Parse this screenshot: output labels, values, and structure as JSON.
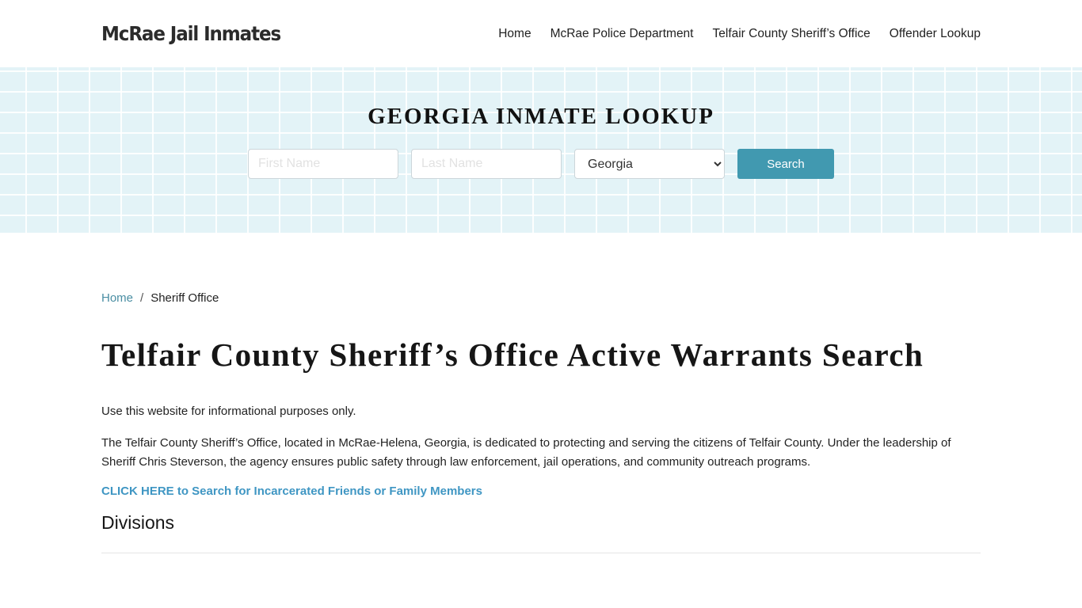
{
  "header": {
    "logo": "McRae Jail Inmates",
    "nav": [
      {
        "label": "Home"
      },
      {
        "label": "McRae Police Department"
      },
      {
        "label": "Telfair County Sheriff’s Office"
      },
      {
        "label": "Offender Lookup"
      }
    ]
  },
  "banner": {
    "title": "GEORGIA INMATE LOOKUP",
    "first_name_placeholder": "First Name",
    "last_name_placeholder": "Last Name",
    "state_selected": "Georgia",
    "search_label": "Search",
    "colors": {
      "background": "#e3f3f7",
      "button": "#4199b0"
    }
  },
  "breadcrumb": {
    "home": "Home",
    "separator": "/",
    "current": "Sheriff Office"
  },
  "main": {
    "title": "Telfair County Sheriff’s Office Active Warrants Search",
    "disclaimer": "Use this website for informational purposes only.",
    "intro": "The Telfair County Sheriff’s Office, located in McRae-Helena, Georgia, is dedicated to protecting and serving the citizens of Telfair County. Under the leadership of Sheriff Chris Steverson, the agency ensures public safety through law enforcement, jail operations, and community outreach programs.",
    "cta_link": "CLICK HERE to Search for Incarcerated Friends or Family Members",
    "section_title": "Divisions",
    "colors": {
      "link": "#3f96c3",
      "breadcrumb_link": "#4a8ea3"
    }
  }
}
